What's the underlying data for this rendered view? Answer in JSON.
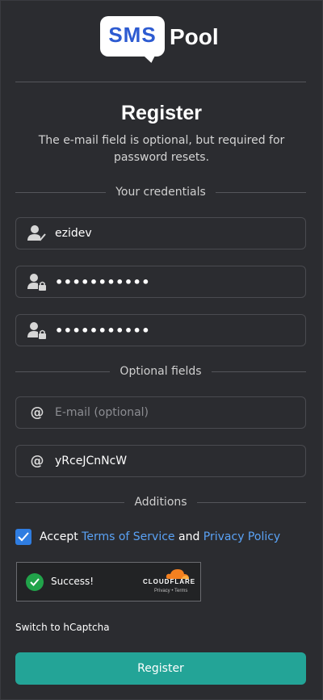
{
  "logo": {
    "sms": "SMS",
    "pool": "Pool"
  },
  "title": "Register",
  "subtitle": "The e-mail field is optional, but required for password resets.",
  "sections": {
    "credentials": "Your credentials",
    "optional": "Optional fields",
    "additions": "Additions"
  },
  "fields": {
    "username": {
      "value": "ezidev",
      "icon": "user-check-icon"
    },
    "password": {
      "value": "•••••••••••",
      "icon": "user-lock-icon"
    },
    "confirm_password": {
      "value": "•••••••••••",
      "icon": "user-lock-icon"
    },
    "email": {
      "placeholder": "E-mail (optional)",
      "icon": "at-icon"
    },
    "referral": {
      "value": "yRceJCnNcW",
      "icon": "at-icon"
    }
  },
  "accept": {
    "checked": true,
    "prefix": "Accept",
    "terms": "Terms of Service",
    "and": "and",
    "privacy": "Privacy Policy"
  },
  "captcha": {
    "status": "Success!",
    "brand": "CLOUDFLARE",
    "privacy": "Privacy",
    "sep": "•",
    "terms": "Terms"
  },
  "switch_captcha": "Switch to hCaptcha",
  "register_button": "Register",
  "colors": {
    "background": "#2b2c30",
    "accent": "#23a497",
    "link": "#5aa2f5",
    "checkbox": "#2f7de1",
    "logo_blue": "#2d5bd1"
  }
}
